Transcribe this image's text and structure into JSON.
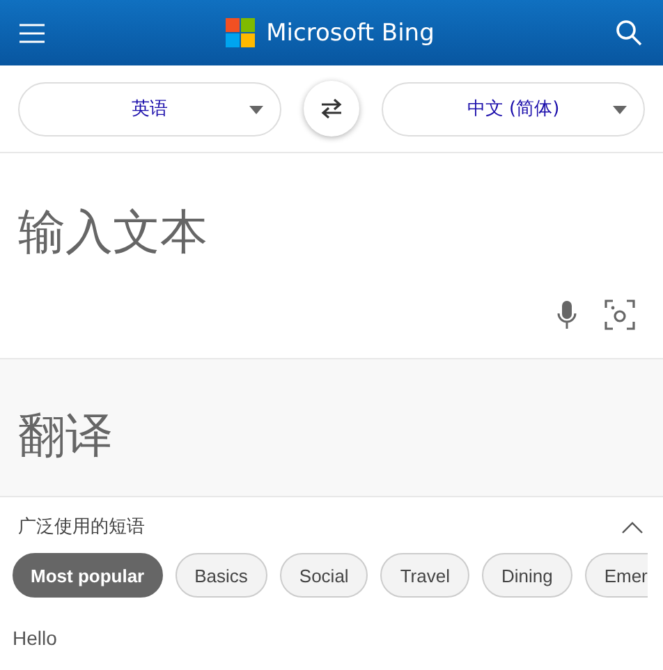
{
  "header": {
    "brand": "Microsoft Bing"
  },
  "languages": {
    "source": "英语",
    "target": "中文 (简体)"
  },
  "input": {
    "placeholder": "输入文本"
  },
  "output": {
    "placeholder": "翻译"
  },
  "phrases": {
    "title": "广泛使用的短语",
    "expanded": true,
    "categories": [
      {
        "label": "Most popular",
        "selected": true
      },
      {
        "label": "Basics",
        "selected": false
      },
      {
        "label": "Social",
        "selected": false
      },
      {
        "label": "Travel",
        "selected": false
      },
      {
        "label": "Dining",
        "selected": false
      },
      {
        "label": "Emer",
        "selected": false
      }
    ],
    "items": [
      {
        "text": "Hello"
      }
    ]
  }
}
